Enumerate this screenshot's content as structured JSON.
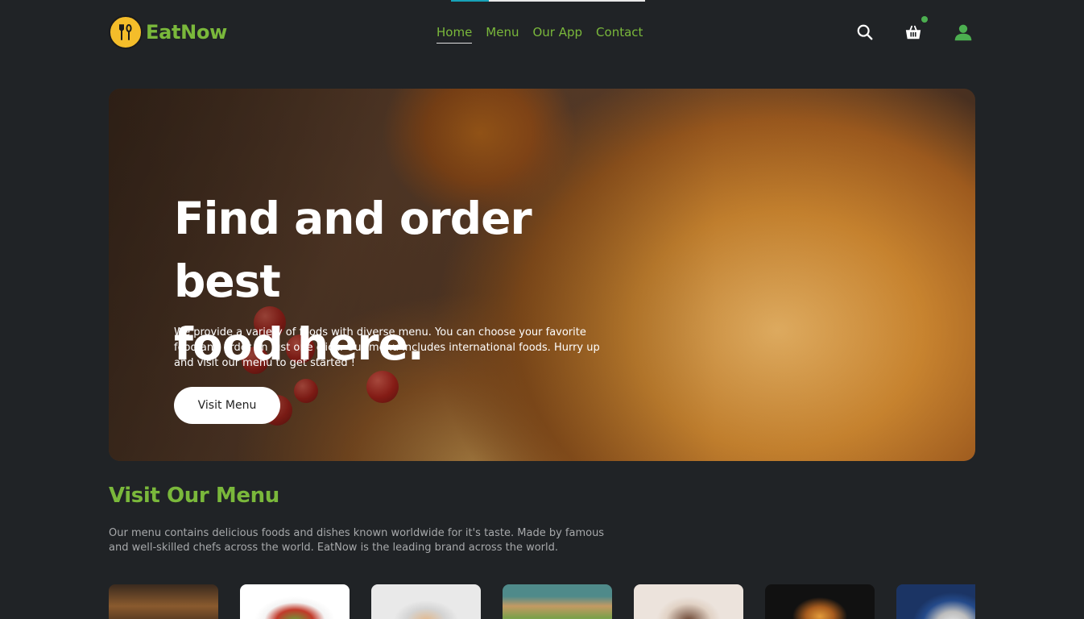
{
  "brand": {
    "name": "EatNow"
  },
  "nav": {
    "items": [
      {
        "label": "Home",
        "active": true
      },
      {
        "label": "Menu",
        "active": false
      },
      {
        "label": "Our App",
        "active": false
      },
      {
        "label": "Contact",
        "active": false
      }
    ]
  },
  "header_icons": [
    "search-icon",
    "cart-icon",
    "user-icon"
  ],
  "hero": {
    "title_line1": "Find and order best",
    "title_line2": "food here.",
    "description": "We provide a variety of foods with diverse menu. You can choose your favorite food and order on just one click. Our menu includes international foods. Hurry up and visit our menu to get started !",
    "button_label": "Visit Menu"
  },
  "menu_section": {
    "heading": "Visit Our Menu",
    "description": "Our menu contains delicious foods and dishes known worldwide for it's taste. Made by famous and well-skilled chefs across the world. EatNow is the leading brand across the world."
  },
  "colors": {
    "background": "#202326",
    "accent": "#7ab83b",
    "logo_yellow": "#f4bd2a",
    "cart_badge": "#4caf50"
  }
}
